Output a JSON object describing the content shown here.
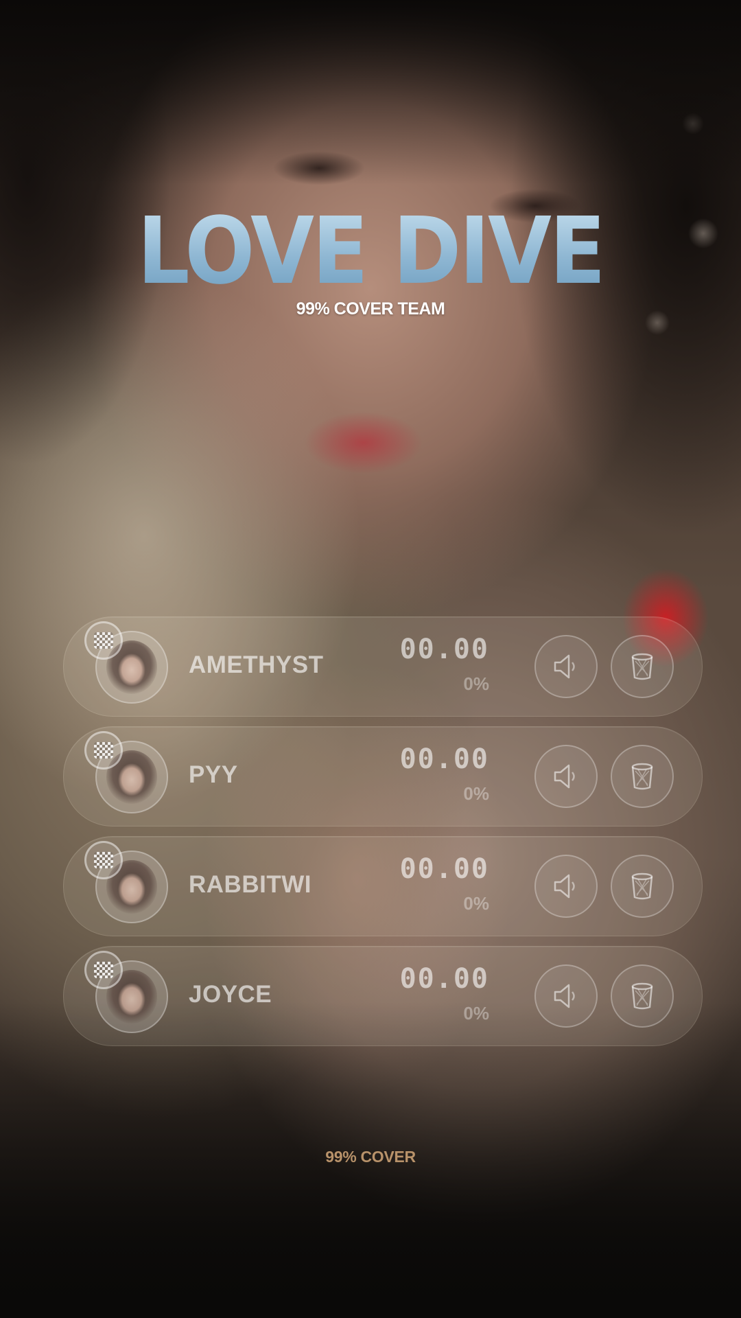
{
  "header": {
    "title": "LOVE DIVE",
    "subtitle": "99% COVER TEAM"
  },
  "tracks": [
    {
      "name": "AMETHYST",
      "time": "00.00",
      "percent": "0%",
      "badge_icon": "checker-icon",
      "mute_icon": "speaker-icon",
      "delete_icon": "trash-icon"
    },
    {
      "name": "PYY",
      "time": "00.00",
      "percent": "0%",
      "badge_icon": "checker-icon",
      "mute_icon": "speaker-icon",
      "delete_icon": "trash-icon"
    },
    {
      "name": "RABBITWI",
      "time": "00.00",
      "percent": "0%",
      "badge_icon": "checker-icon",
      "mute_icon": "speaker-icon",
      "delete_icon": "trash-icon"
    },
    {
      "name": "JOYCE",
      "time": "00.00",
      "percent": "0%",
      "badge_icon": "checker-icon",
      "mute_icon": "speaker-icon",
      "delete_icon": "trash-icon"
    }
  ],
  "footer": {
    "label": "99% COVER"
  },
  "colors": {
    "title": "#9dc3dd",
    "footer": "#b8926a",
    "card": "rgba(255,245,230,0.10)"
  }
}
